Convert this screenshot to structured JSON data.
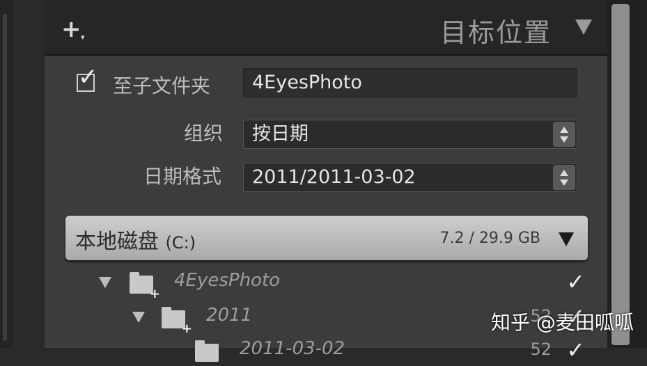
{
  "header": {
    "title": "目标位置",
    "add_icon": "plus-icon"
  },
  "subfolder": {
    "checked": true,
    "label": "至子文件夹",
    "value": "4EyesPhoto"
  },
  "organize": {
    "label": "组织",
    "value": "按日期"
  },
  "date_format": {
    "label": "日期格式",
    "value": "2011/2011-03-02"
  },
  "disk": {
    "name": "本地磁盘",
    "drive": "(C:)",
    "size": "7.2 / 29.9 GB"
  },
  "tree": [
    {
      "label": "4EyesPhoto",
      "count": "",
      "check": "✓"
    },
    {
      "label": "2011",
      "count": "52",
      "check": "✓"
    },
    {
      "label": "2011-03-02",
      "count": "52",
      "check": "✓"
    }
  ],
  "watermark": "知乎 @麦田呱呱"
}
